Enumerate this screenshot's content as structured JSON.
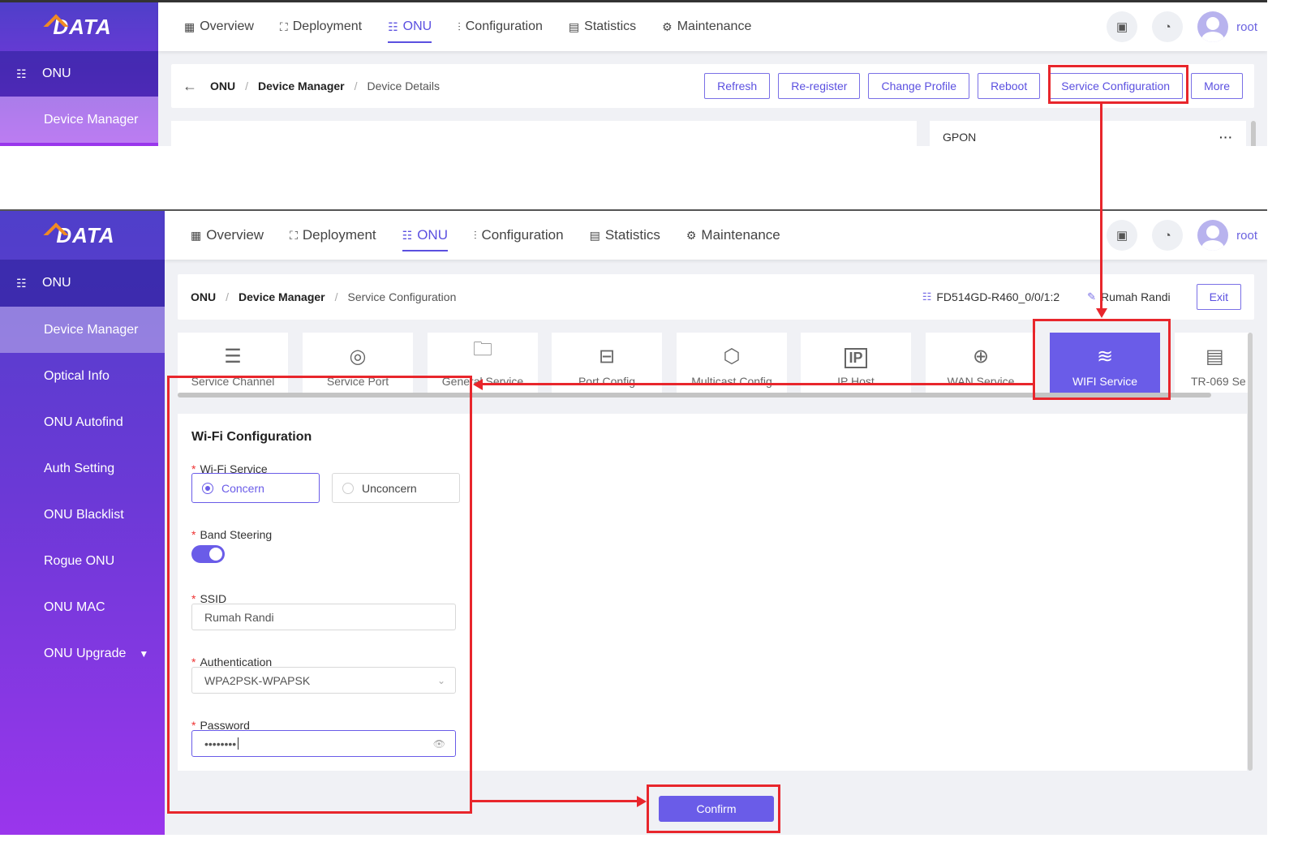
{
  "brand": {
    "logo_text": "DATA",
    "accent": "#6a5ce8",
    "highlight": "#e8262c"
  },
  "nav": {
    "items": [
      {
        "label": "Overview",
        "icon": "grid-icon",
        "glyph": "▦"
      },
      {
        "label": "Deployment",
        "icon": "topology-icon",
        "glyph": "⛶"
      },
      {
        "label": "ONU",
        "icon": "onu-icon",
        "glyph": "☷",
        "active": true
      },
      {
        "label": "Configuration",
        "icon": "sliders-icon",
        "glyph": "⫶"
      },
      {
        "label": "Statistics",
        "icon": "stats-icon",
        "glyph": "▤"
      },
      {
        "label": "Maintenance",
        "icon": "gear-icon",
        "glyph": "⚙"
      }
    ],
    "save_icon": "▣",
    "dashboard_icon": "◔",
    "user": "root"
  },
  "sidebar": {
    "section": "ONU",
    "items": [
      "Device Manager",
      "Optical Info",
      "ONU Autofind",
      "Auth Setting",
      "ONU Blacklist",
      "Rogue ONU",
      "ONU MAC",
      "ONU Upgrade"
    ]
  },
  "top_panel": {
    "back": "←",
    "crumbs": [
      "ONU",
      "Device Manager",
      "Device Details"
    ],
    "buttons": [
      "Refresh",
      "Re-register",
      "Change Profile",
      "Reboot",
      "Service Configuration",
      "More"
    ],
    "card_title": "GPON",
    "card_more": "···"
  },
  "bottom_panel": {
    "crumbs": [
      "ONU",
      "Device Manager",
      "Service Configuration"
    ],
    "device_name": "FD514GD-R460_0/0/1:2",
    "device_desc": "Rumah Randi",
    "exit": "Exit",
    "tabs": [
      {
        "label": "Service Channel",
        "glyph": "☰"
      },
      {
        "label": "Service Port",
        "glyph": "◎"
      },
      {
        "label": "General Service",
        "glyph": "🗀"
      },
      {
        "label": "Port Config",
        "glyph": "⊟"
      },
      {
        "label": "Multicast Config",
        "glyph": "⬡"
      },
      {
        "label": "IP Host",
        "glyph": "IP"
      },
      {
        "label": "WAN Service",
        "glyph": "⊕"
      },
      {
        "label": "WIFI Service",
        "glyph": "≋",
        "active": true
      },
      {
        "label": "TR-069 Se",
        "glyph": "▤"
      }
    ]
  },
  "form": {
    "title": "Wi-Fi Configuration",
    "wifi_service": {
      "label": "Wi-Fi  Service",
      "options": [
        "Concern",
        "Unconcern"
      ],
      "selected": "Concern"
    },
    "band_steering": {
      "label": "Band Steering",
      "enabled": true
    },
    "ssid": {
      "label": "SSID",
      "value": "Rumah Randi"
    },
    "authentication": {
      "label": "Authentication",
      "value": "WPA2PSK-WPAPSK"
    },
    "password": {
      "label": "Password",
      "value": "••••••••"
    },
    "required_mark": "*",
    "confirm": "Confirm"
  }
}
